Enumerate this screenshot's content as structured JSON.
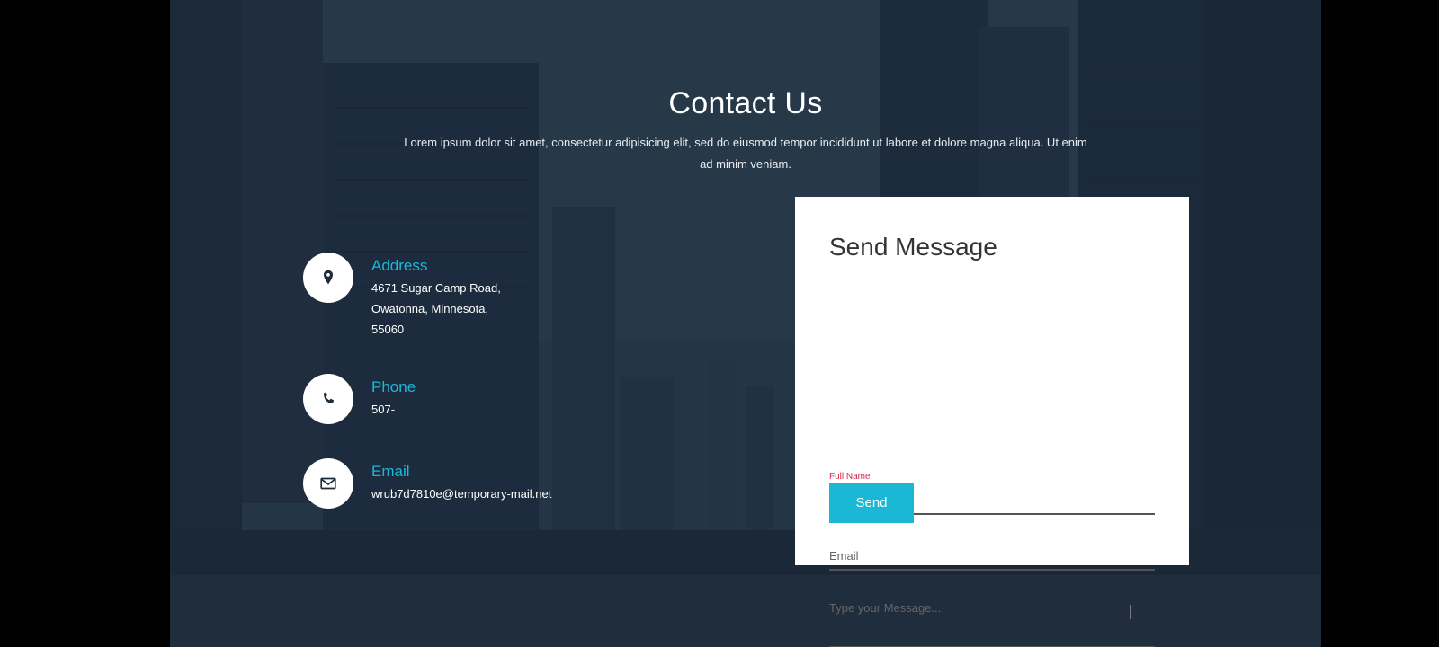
{
  "header": {
    "title": "Contact Us",
    "description": "Lorem ipsum dolor sit amet, consectetur adipisicing elit, sed do eiusmod tempor incididunt ut labore et dolore magna aliqua. Ut enim ad minim veniam."
  },
  "contact_info": {
    "address": {
      "icon": "map-marker-icon",
      "title": "Address",
      "line1": "4671 Sugar Camp Road,",
      "line2": "Owatonna, Minnesota,",
      "line3": "55060"
    },
    "phone": {
      "icon": "phone-icon",
      "title": "Phone",
      "value": "507-"
    },
    "email": {
      "icon": "envelope-icon",
      "title": "Email",
      "value": "wrub7d7810e@temporary-mail.net"
    }
  },
  "form": {
    "title": "Send Message",
    "full_name_label": "Full Name",
    "full_name_value": "",
    "email_placeholder": "Email",
    "message_placeholder": "Type your Message...",
    "send_label": "Send"
  },
  "colors": {
    "accent": "#1ab8d5",
    "label_active": "#d12a4a",
    "background_overlay": "#2b3a4c"
  }
}
